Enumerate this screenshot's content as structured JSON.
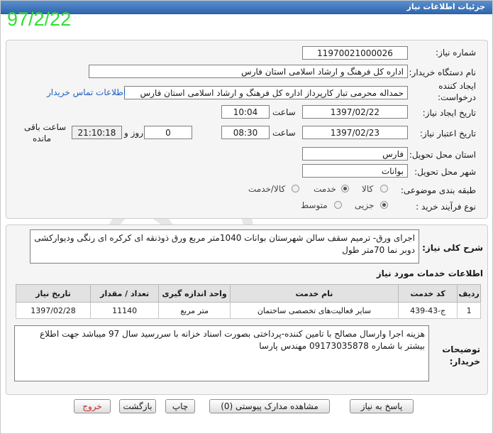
{
  "window": {
    "title": "جزئیات اطلاعات نیاز"
  },
  "stamp_date": "97/2/22",
  "form": {
    "need_number": {
      "label": "شماره نیاز:",
      "value": "1197002100002‌6"
    },
    "buyer_org": {
      "label": "نام دستگاه خریدار:",
      "value": "اداره کل فرهنگ و ارشاد اسلامی استان فارس"
    },
    "creator": {
      "label_line1": "ایجاد کننده",
      "label_line2": "درخواست:",
      "value": "حمداله محرمی تبار کارپرداز اداره کل فرهنگ و ارشاد اسلامی استان فارس",
      "contact_link": "اطلاعات تماس خریدار"
    },
    "created": {
      "label": "تاریخ ایجاد نیاز:",
      "date": "1397/02/22",
      "time_label": "ساعت",
      "time": "10:04"
    },
    "validity": {
      "label": "تاریخ اعتبار نیاز:",
      "date": "1397/02/23",
      "time_label": "ساعت",
      "time": "08:30",
      "days": "0",
      "days_label": "روز و",
      "remaining": "21:10:18",
      "remaining_label_line1": "ساعت باقی",
      "remaining_label_line2": "مانده"
    },
    "province": {
      "label": "استان محل تحویل:",
      "value": "فارس"
    },
    "city": {
      "label": "شهر محل تحویل:",
      "value": "بوانات"
    },
    "category": {
      "label": "طبقه بندی موضوعی:",
      "options": [
        "کالا",
        "خدمت",
        "کالا/خدمت"
      ],
      "selected": "خدمت"
    },
    "process": {
      "label": "نوع فرآیند خرید :",
      "options": [
        "جزیی",
        "متوسط"
      ],
      "selected": "جزیی"
    }
  },
  "description": {
    "label": "شرح کلی نیاز:",
    "text": "اجرای ورق- ترمیم سقف سالن شهرستان بوانات 1040متر مربع ورق ذوذنقه ای کرکره ای رنگی ودیوارکشی دوبر نما 70متر طول"
  },
  "services": {
    "section_title": "اطلاعات خدمات مورد نیاز",
    "headers": [
      "ردیف",
      "کد خدمت",
      "نام خدمت",
      "واحد اندازه گیری",
      "تعداد / مقدار",
      "تاریخ نیاز"
    ],
    "rows": [
      {
        "row": "1",
        "code": "ج-43-439",
        "name": "سایر فعالیت‌های تخصصی ساختمان",
        "unit": "متر مربع",
        "qty": "11140",
        "date": "1397/02/28"
      }
    ]
  },
  "buyer_notes": {
    "label_line1": "توضیحات",
    "label_line2": "خریدار:",
    "text": "هزینه اجرا وارسال مصالح با تامین کننده-پرداختی بصورت اسناد خزانه با سررسید سال 97 میباشد جهت اطلاع بیشتر با شماره 09173035878 مهندس پارسا"
  },
  "buttons": {
    "reply": "پاسخ به نیاز",
    "attachments": "مشاهده مدارک پیوستی (0)",
    "print": "چاپ",
    "back": "بازگشت",
    "exit": "خروج"
  },
  "colors": {
    "titlebar": "#3a72b8",
    "stamp": "#2fe02f",
    "link": "#1f5fbf",
    "exit_text": "#c03030"
  }
}
